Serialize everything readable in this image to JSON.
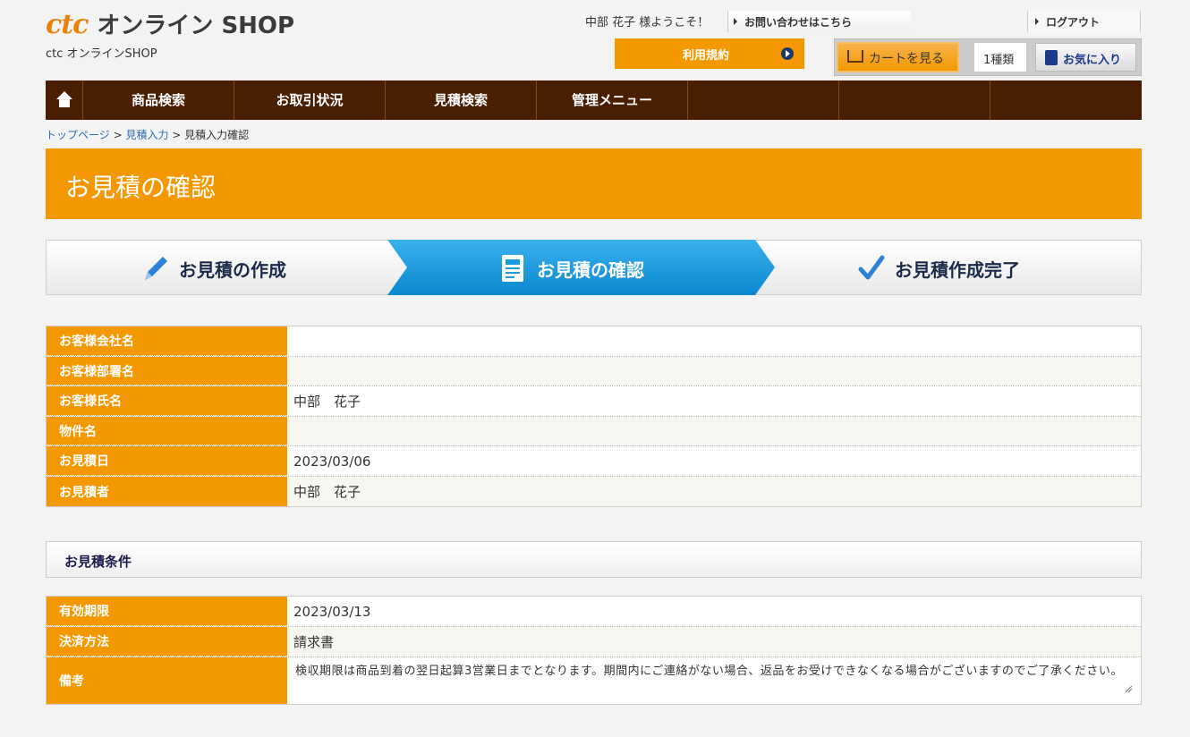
{
  "header": {
    "logo_brand": "ctc",
    "logo_text": "オンライン SHOP",
    "logo_sub": "ctc オンラインSHOP",
    "welcome": "中部 花子 様ようこそ！",
    "contact_link": "お問い合わせはこちら",
    "logout_link": "ログアウト",
    "terms_button": "利用規約",
    "cart_button": "カートを見る",
    "cart_count": "1種類",
    "favorites_button": "お気に入り"
  },
  "nav": {
    "items": [
      "商品検索",
      "お取引状況",
      "見積検索",
      "管理メニュー",
      "",
      "",
      ""
    ]
  },
  "breadcrumb": {
    "top": "トップページ",
    "input": "見積入力",
    "current": "見積入力確認",
    "sep": " > "
  },
  "page_title": "お見積の確認",
  "steps": {
    "step1": "お見積の作成",
    "step2": "お見積の確認",
    "step3": "お見積作成完了"
  },
  "customer_table": [
    {
      "label": "お客様会社名",
      "value": ""
    },
    {
      "label": "お客様部署名",
      "value": ""
    },
    {
      "label": "お客様氏名",
      "value": "中部　花子"
    },
    {
      "label": "物件名",
      "value": ""
    },
    {
      "label": "お見積日",
      "value": "2023/03/06"
    },
    {
      "label": "お見積者",
      "value": "中部　花子"
    }
  ],
  "conditions": {
    "heading": "お見積条件",
    "rows": [
      {
        "label": "有効期限",
        "value": "2023/03/13"
      },
      {
        "label": "決済方法",
        "value": "請求書"
      },
      {
        "label": "備考",
        "value": "検収期限は商品到着の翌日起算3営業日までとなります。期間内にご連絡がない場合、返品をお受けできなくなる場合がございますのでご了承ください。"
      }
    ]
  },
  "colors": {
    "accent": "#f39800",
    "nav_bg": "#4a1e00",
    "step_active": "#1a9be0",
    "link": "#2a6fb3"
  }
}
